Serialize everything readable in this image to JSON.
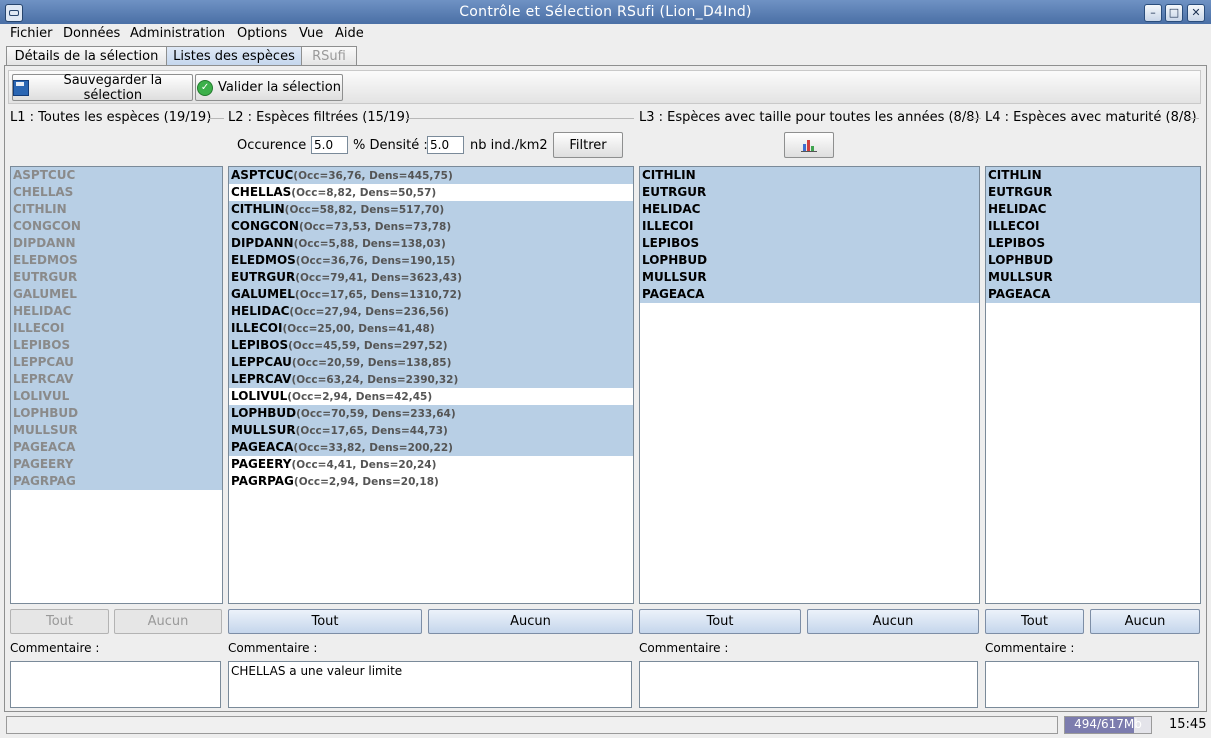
{
  "window": {
    "title": "Contrôle et Sélection RSufi (Lion_D4Ind)"
  },
  "menu": [
    "Fichier",
    "Données",
    "Administration",
    "Options",
    "Vue",
    "Aide"
  ],
  "tabs": [
    {
      "label": "Détails de la sélection",
      "state": "normal"
    },
    {
      "label": "Listes des espèces",
      "state": "active"
    },
    {
      "label": "RSufi",
      "state": "disabled"
    }
  ],
  "toolbar": {
    "save_label": "Sauvegarder la sélection",
    "validate_label": "Valider la sélection"
  },
  "l1": {
    "title": "L1 : Toutes les espèces (19/19)",
    "items": [
      "ASPTCUC",
      "CHELLAS",
      "CITHLIN",
      "CONGCON",
      "DIPDANN",
      "ELEDMOS",
      "EUTRGUR",
      "GALUMEL",
      "HELIDAC",
      "ILLECOI",
      "LEPIBOS",
      "LEPPCAU",
      "LEPRCAV",
      "LOLIVUL",
      "LOPHBUD",
      "MULLSUR",
      "PAGEACA",
      "PAGEERY",
      "PAGRPAG"
    ],
    "all_label": "Tout",
    "none_label": "Aucun"
  },
  "l2": {
    "title": "L2 : Espèces filtrées (15/19)",
    "occ_label": "Occurence :",
    "occ_value": "5.0",
    "dens_label": "% Densité :",
    "dens_value": "5.0",
    "unit_label": "nb ind./km2",
    "filter_label": "Filtrer",
    "items": [
      {
        "code": "ASPTCUC",
        "stats": "(Occ=36,76, Dens=445,75)",
        "selected": true
      },
      {
        "code": "CHELLAS",
        "stats": "(Occ=8,82, Dens=50,57)",
        "selected": false
      },
      {
        "code": "CITHLIN",
        "stats": "(Occ=58,82, Dens=517,70)",
        "selected": true
      },
      {
        "code": "CONGCON",
        "stats": "(Occ=73,53, Dens=73,78)",
        "selected": true
      },
      {
        "code": "DIPDANN",
        "stats": "(Occ=5,88, Dens=138,03)",
        "selected": true
      },
      {
        "code": "ELEDMOS",
        "stats": "(Occ=36,76, Dens=190,15)",
        "selected": true
      },
      {
        "code": "EUTRGUR",
        "stats": "(Occ=79,41, Dens=3623,43)",
        "selected": true
      },
      {
        "code": "GALUMEL",
        "stats": "(Occ=17,65, Dens=1310,72)",
        "selected": true
      },
      {
        "code": "HELIDAC",
        "stats": "(Occ=27,94, Dens=236,56)",
        "selected": true
      },
      {
        "code": "ILLECOI",
        "stats": "(Occ=25,00, Dens=41,48)",
        "selected": true
      },
      {
        "code": "LEPIBOS",
        "stats": "(Occ=45,59, Dens=297,52)",
        "selected": true
      },
      {
        "code": "LEPPCAU",
        "stats": "(Occ=20,59, Dens=138,85)",
        "selected": true
      },
      {
        "code": "LEPRCAV",
        "stats": "(Occ=63,24, Dens=2390,32)",
        "selected": true
      },
      {
        "code": "LOLIVUL",
        "stats": "(Occ=2,94, Dens=42,45)",
        "selected": false
      },
      {
        "code": "LOPHBUD",
        "stats": "(Occ=70,59, Dens=233,64)",
        "selected": true
      },
      {
        "code": "MULLSUR",
        "stats": "(Occ=17,65, Dens=44,73)",
        "selected": true
      },
      {
        "code": "PAGEACA",
        "stats": "(Occ=33,82, Dens=200,22)",
        "selected": true
      },
      {
        "code": "PAGEERY",
        "stats": "(Occ=4,41, Dens=20,24)",
        "selected": false
      },
      {
        "code": "PAGRPAG",
        "stats": "(Occ=2,94, Dens=20,18)",
        "selected": false
      }
    ],
    "all_label": "Tout",
    "none_label": "Aucun"
  },
  "l3": {
    "title": "L3 : Espèces avec taille pour toutes les années (8/8)",
    "items": [
      "CITHLIN",
      "EUTRGUR",
      "HELIDAC",
      "ILLECOI",
      "LEPIBOS",
      "LOPHBUD",
      "MULLSUR",
      "PAGEACA"
    ],
    "all_label": "Tout",
    "none_label": "Aucun"
  },
  "l4": {
    "title": "L4 : Espèces avec maturité (8/8)",
    "items": [
      "CITHLIN",
      "EUTRGUR",
      "HELIDAC",
      "ILLECOI",
      "LEPIBOS",
      "LOPHBUD",
      "MULLSUR",
      "PAGEACA"
    ],
    "all_label": "Tout",
    "none_label": "Aucun"
  },
  "comments": {
    "label": "Commentaire :",
    "l1": "",
    "l2": "CHELLAS a une valeur limite",
    "l3": "",
    "l4": ""
  },
  "status": {
    "memory": "494/617Mb",
    "memory_fraction": 0.8,
    "clock": "15:45"
  },
  "icons": {
    "app": "app-icon",
    "minimize": "minimize-icon",
    "maximize": "maximize-icon",
    "close": "close-icon",
    "save": "save-icon",
    "validate": "check-icon",
    "chart": "bar-chart-icon"
  }
}
